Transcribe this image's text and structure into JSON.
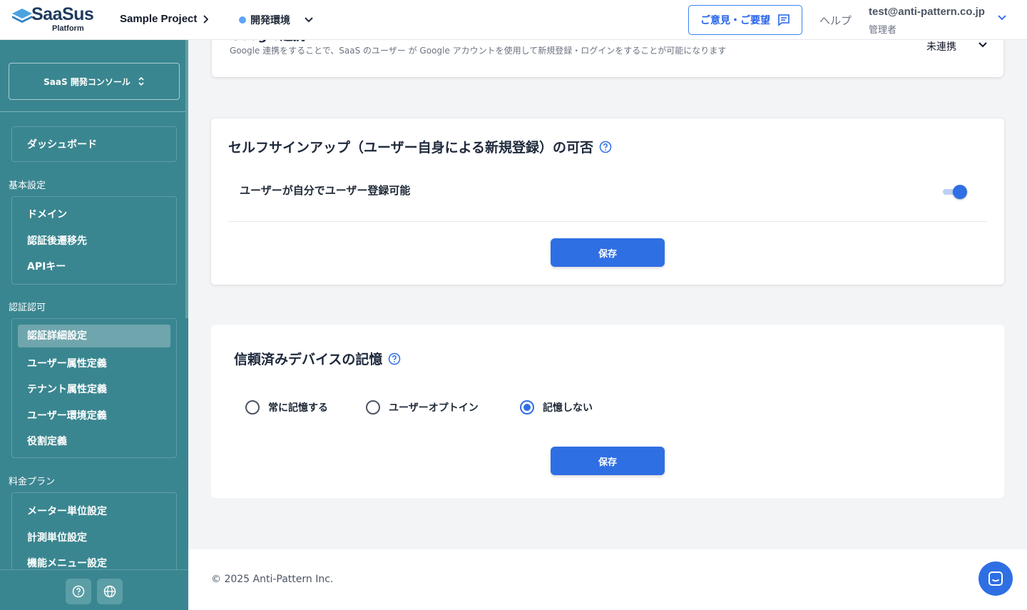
{
  "header": {
    "logo_text": "SaaSus",
    "logo_sub": "Platform",
    "project": "Sample Project",
    "env": "開発環境",
    "feedback": "ご意見・ご要望",
    "help": "ヘルプ",
    "user_email": "test@anti-pattern.co.jp",
    "user_role": "管理者"
  },
  "sidebar": {
    "console": "SaaS 開発コンソール",
    "dashboard": "ダッシュボード",
    "sections": [
      {
        "label": "基本設定",
        "items": [
          "ドメイン",
          "認証後遷移先",
          "APIキー"
        ]
      },
      {
        "label": "認証認可",
        "items": [
          "認証詳細設定",
          "ユーザー属性定義",
          "テナント属性定義",
          "ユーザー環境定義",
          "役割定義"
        ]
      },
      {
        "label": "料金プラン",
        "items": [
          "メーター単位設定",
          "計測単位設定",
          "機能メニュー設定"
        ]
      }
    ]
  },
  "google": {
    "title": "Google連携",
    "desc": "Google 連携をすることで、SaaS のユーザー が Google アカウントを使用して新規登録・ログインをすることが可能になります",
    "status": "未連携"
  },
  "selfsignup": {
    "title": "セルフサインアップ（ユーザー自身による新規登録）の可否",
    "row_label": "ユーザーが自分でユーザー登録可能",
    "enabled": true,
    "save": "保存"
  },
  "trusted": {
    "title": "信頼済みデバイスの記憶",
    "options": [
      "常に記憶する",
      "ユーザーオプトイン",
      "記憶しない"
    ],
    "selected": "記憶しない",
    "save": "保存"
  },
  "footer": {
    "copyright": "© 2025 Anti-Pattern Inc."
  },
  "colors": {
    "accent": "#2f6fe4",
    "sidebar": "#3a8690"
  }
}
